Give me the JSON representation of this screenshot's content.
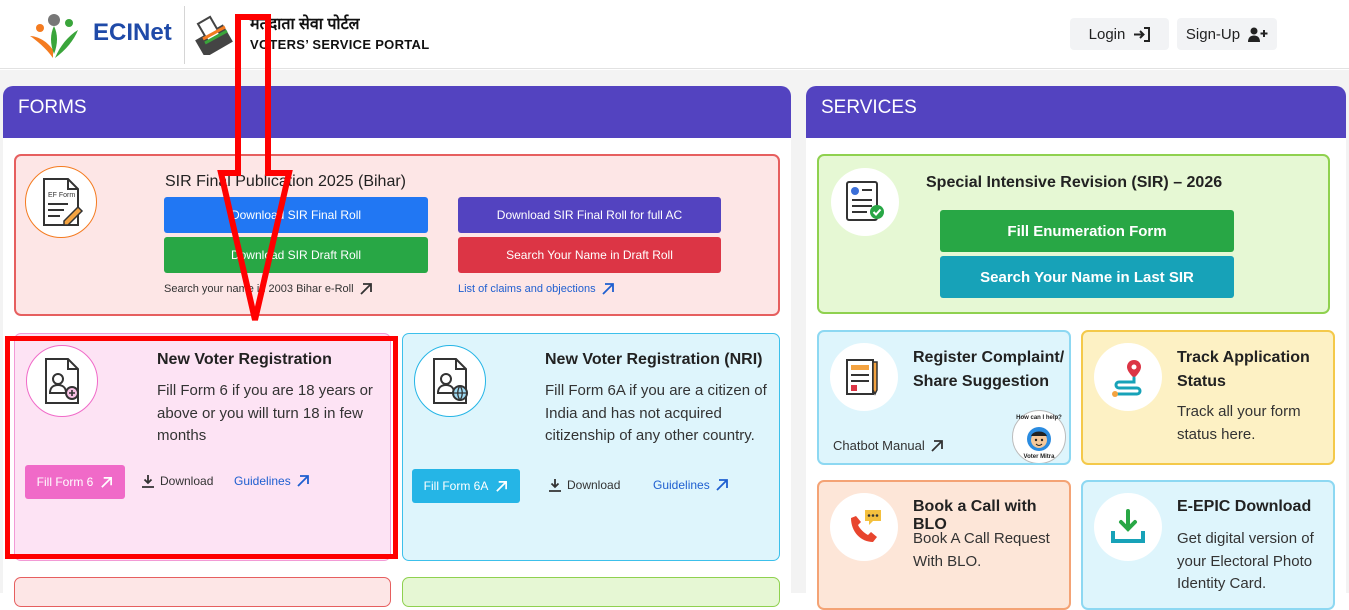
{
  "header": {
    "brand": "ECINet",
    "portal_hindi": "मतदाता सेवा पोर्टल",
    "portal_english": "VOTERS’ SERVICE PORTAL",
    "login_label": "Login",
    "signup_label": "Sign-Up"
  },
  "forms": {
    "heading": "FORMS",
    "sir": {
      "icon_label": "EF Form",
      "title": "SIR Final Publication 2025 (Bihar)",
      "download_final": "Download SIR Final Roll",
      "download_final_ac": "Download SIR Final Roll for full AC",
      "download_draft": "Download SIR Draft Roll",
      "search_draft": "Search Your Name in Draft Roll",
      "search_2003": "Search your name in 2003 Bihar e-Roll",
      "claims": "List of claims and objections"
    },
    "form6": {
      "title": "New Voter Registration",
      "desc": "Fill Form 6 if you are 18 years or above or you will turn 18 in few months",
      "fill": "Fill Form 6",
      "download": "Download",
      "guidelines": "Guidelines"
    },
    "form6a": {
      "title": "New Voter Registration (NRI)",
      "desc": "Fill Form 6A if you are a citizen of India and has not acquired citizenship of any other country.",
      "fill": "Fill Form 6A",
      "download": "Download",
      "guidelines": "Guidelines"
    }
  },
  "services": {
    "heading": "SERVICES",
    "sir2026": {
      "title": "Special Intensive Revision (SIR) – 2026",
      "fill": "Fill Enumeration Form",
      "search": "Search Your Name in Last SIR"
    },
    "complaint": {
      "title": "Register Complaint/ Share Suggestion",
      "chatbot": "Chatbot Manual",
      "mascot_text": "How can I help?",
      "mascot_name": "Voter Mitra"
    },
    "track": {
      "title": "Track Application Status",
      "desc": "Track all your form status here."
    },
    "blo": {
      "title": "Book a Call with BLO",
      "desc": "Book A Call Request With BLO."
    },
    "epic": {
      "title": "E-EPIC Download",
      "desc": "Get digital version of your Electoral Photo Identity Card."
    }
  },
  "colors": {
    "header_band": "#5343c0",
    "blue": "#2177f3",
    "purple": "#5343c0",
    "green": "#28a745",
    "red": "#dc3545",
    "teal": "#17a2b8",
    "pink": "#f06ac8",
    "cyan": "#25b5e6",
    "annotation": "#ff0000"
  }
}
